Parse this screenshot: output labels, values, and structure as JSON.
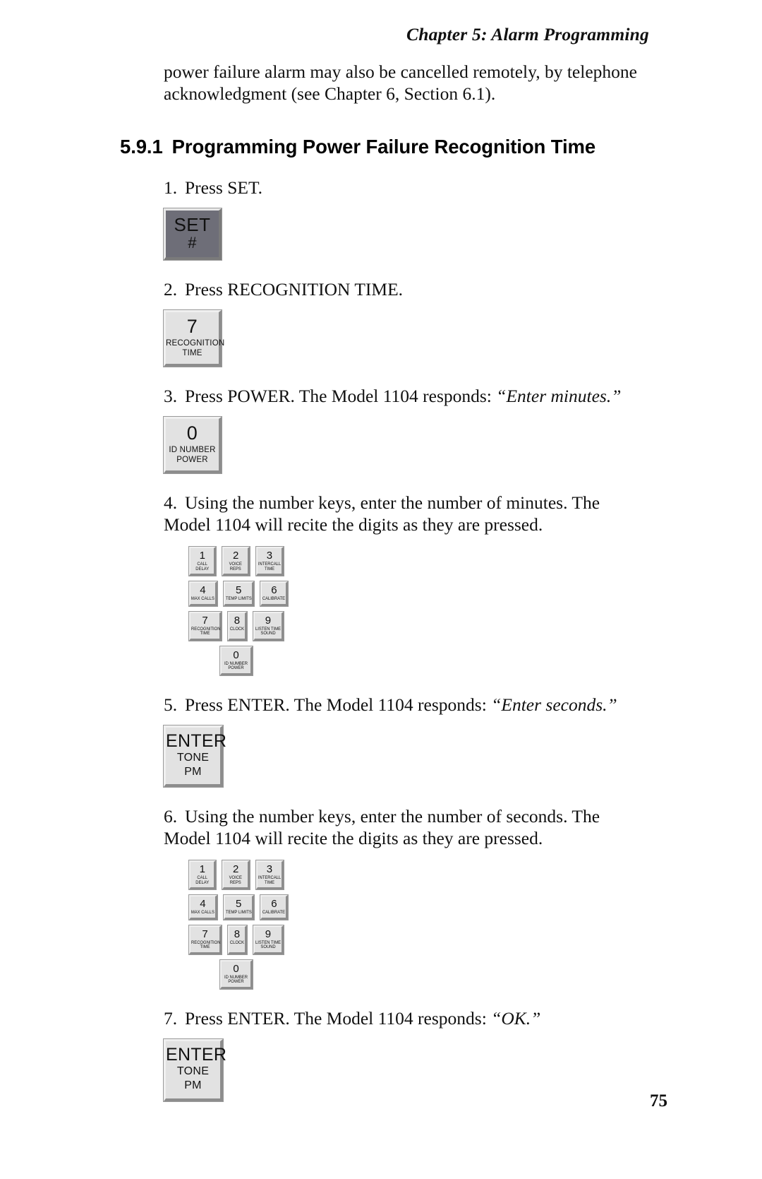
{
  "header": {
    "chapter_title": "Chapter 5: Alarm Programming"
  },
  "body": {
    "intro_paragraph": "power failure alarm may also be cancelled remotely, by telephone acknowledgment (see Chapter 6, Section 6.1).",
    "section": {
      "number": "5.9.1",
      "title": "Programming Power Failure Recognition Time"
    }
  },
  "steps": [
    {
      "n": "1.",
      "text": "Press SET."
    },
    {
      "n": "2.",
      "text": "Press RECOGNITION TIME."
    },
    {
      "n": "3.",
      "text_before": "Press POWER. The Model 1104 responds: ",
      "quote": "“Enter minutes.”"
    },
    {
      "n": "4.",
      "text": "Using the number keys, enter the number of minutes. The Model 1104 will recite the digits as they are pressed."
    },
    {
      "n": "5.",
      "text_before": "Press ENTER. The Model 1104 responds: ",
      "quote": "“Enter seconds.”"
    },
    {
      "n": "6.",
      "text": "Using the number keys, enter the number of seconds. The Model 1104 will recite the digits as they are pressed."
    },
    {
      "n": "7.",
      "text_before": "Press ENTER. The Model 1104 responds: ",
      "quote": "“OK.”"
    }
  ],
  "keys": {
    "set": {
      "glyph": "SET",
      "line1": "#",
      "line2": ""
    },
    "seven": {
      "glyph": "7",
      "line1": "RECOGNITION",
      "line2": "TIME"
    },
    "zero": {
      "glyph": "0",
      "line1": "ID NUMBER",
      "line2": "POWER"
    },
    "enter": {
      "glyph": "ENTER",
      "line1": "TONE",
      "line2": "PM"
    }
  },
  "keypad": {
    "rows": [
      [
        {
          "glyph": "1",
          "line1": "CALL",
          "line2": "DELAY"
        },
        {
          "glyph": "2",
          "line1": "VOICE",
          "line2": "REPS"
        },
        {
          "glyph": "3",
          "line1": "INTERCALL",
          "line2": "TIME"
        }
      ],
      [
        {
          "glyph": "4",
          "line1": "MAX CALLS",
          "line2": ""
        },
        {
          "glyph": "5",
          "line1": "TEMP LIMITS",
          "line2": ""
        },
        {
          "glyph": "6",
          "line1": "CALIBRATE",
          "line2": ""
        }
      ],
      [
        {
          "glyph": "7",
          "line1": "RECOGNITION",
          "line2": "TIME"
        },
        {
          "glyph": "8",
          "line1": "CLOCK",
          "line2": ""
        },
        {
          "glyph": "9",
          "line1": "LISTEN TIME",
          "line2": "SOUND"
        }
      ],
      [
        {
          "glyph": "0",
          "line1": "ID NUMBER",
          "line2": "POWER"
        }
      ]
    ]
  },
  "footer": {
    "page_number": "75"
  },
  "colors": {
    "key_face": "#e2e2e2",
    "key_dark_face": "#6e6e78",
    "key_border_light": "#f0f0f0",
    "key_border_dark": "#8d8d8d",
    "text": "#111111"
  }
}
